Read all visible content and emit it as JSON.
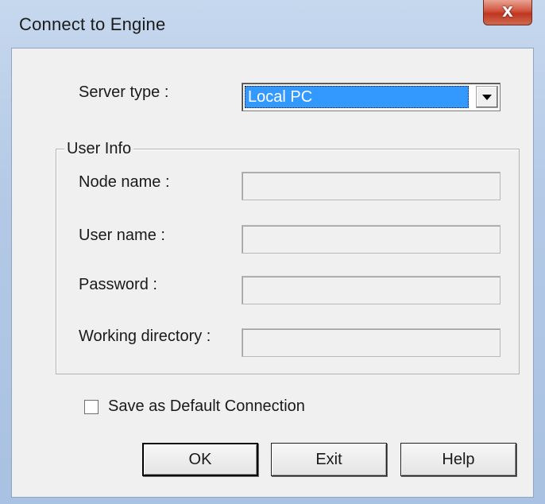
{
  "window": {
    "title": "Connect to Engine",
    "close_glyph": "X"
  },
  "server": {
    "label": "Server type :",
    "selected": "Local PC"
  },
  "user_info": {
    "group_title": "User Info",
    "fields": [
      {
        "label": "Node name :",
        "value": ""
      },
      {
        "label": "User name :",
        "value": ""
      },
      {
        "label": "Password :",
        "value": ""
      },
      {
        "label": "Working directory :",
        "value": ""
      }
    ]
  },
  "save_default": {
    "label": "Save as Default Connection",
    "checked": false
  },
  "buttons": {
    "ok": "OK",
    "exit": "Exit",
    "help": "Help"
  },
  "colors": {
    "selection": "#3399ff",
    "dialog_bg": "#f0f0f0",
    "close_red": "#c0351e"
  }
}
